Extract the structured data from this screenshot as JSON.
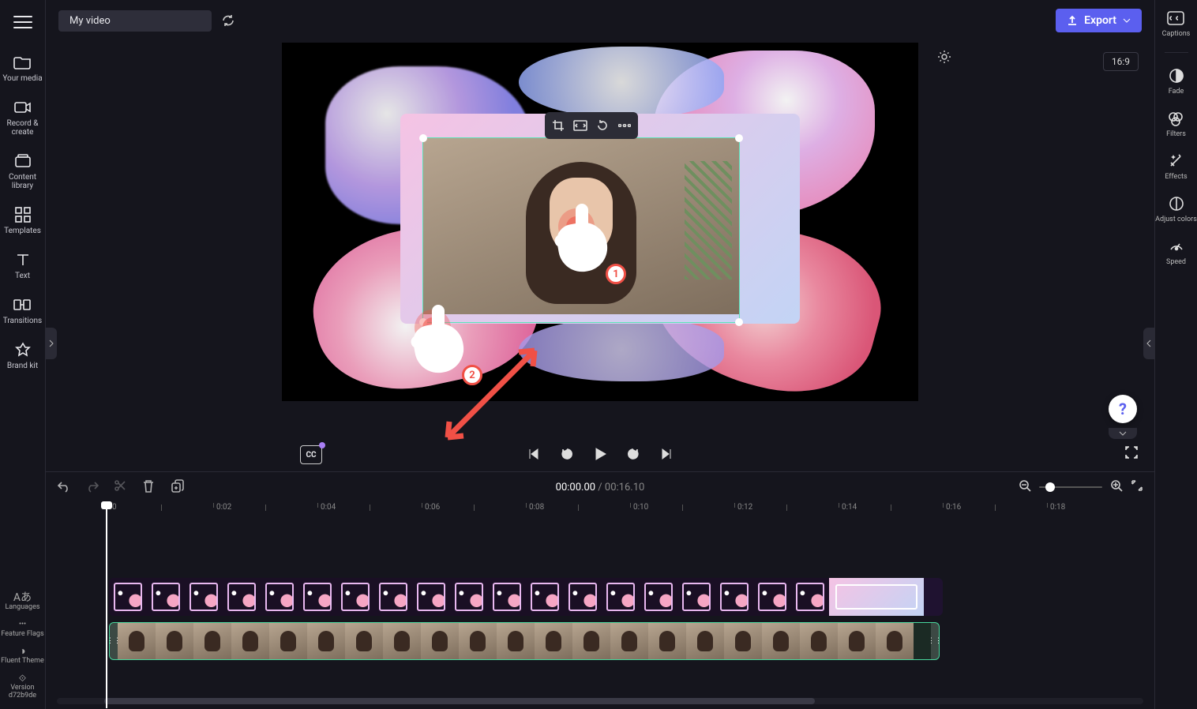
{
  "topbar": {
    "project_name": "My video",
    "export_label": "Export"
  },
  "sidebar_left": {
    "items": [
      {
        "label": "Your media",
        "icon": "folder-icon"
      },
      {
        "label": "Record & create",
        "icon": "camera-icon"
      },
      {
        "label": "Content library",
        "icon": "library-icon"
      },
      {
        "label": "Templates",
        "icon": "templates-icon"
      },
      {
        "label": "Text",
        "icon": "text-icon"
      },
      {
        "label": "Transitions",
        "icon": "transitions-icon"
      },
      {
        "label": "Brand kit",
        "icon": "brand-kit-icon"
      }
    ],
    "dev": [
      {
        "label": "Languages"
      },
      {
        "label": "Feature Flags"
      },
      {
        "label": "Fluent Theme"
      },
      {
        "label": "Version d72b9de"
      }
    ]
  },
  "sidebar_right": {
    "items": [
      {
        "label": "Captions",
        "icon": "captions-icon"
      },
      {
        "label": "Fade",
        "icon": "fade-icon"
      },
      {
        "label": "Filters",
        "icon": "filters-icon"
      },
      {
        "label": "Effects",
        "icon": "effects-icon"
      },
      {
        "label": "Adjust colors",
        "icon": "adjust-colors-icon"
      },
      {
        "label": "Speed",
        "icon": "speed-icon"
      }
    ]
  },
  "preview": {
    "aspect_ratio": "16:9",
    "float_toolbar": {
      "crop": "crop-icon",
      "fit": "fit-icon",
      "pip": "picture-in-picture-icon",
      "more": "more-icon"
    }
  },
  "tutorial": {
    "hand1": "1",
    "hand2": "2"
  },
  "playback": {
    "cc_label": "CC"
  },
  "timeline": {
    "current": "00:00.00",
    "separator": " / ",
    "total": "00:16.10",
    "ruler_start": "0",
    "ruler": [
      "0:02",
      "0:04",
      "0:06",
      "0:08",
      "0:10",
      "0:12",
      "0:14",
      "0:16",
      "0:18"
    ]
  },
  "help": {
    "symbol": "?"
  }
}
